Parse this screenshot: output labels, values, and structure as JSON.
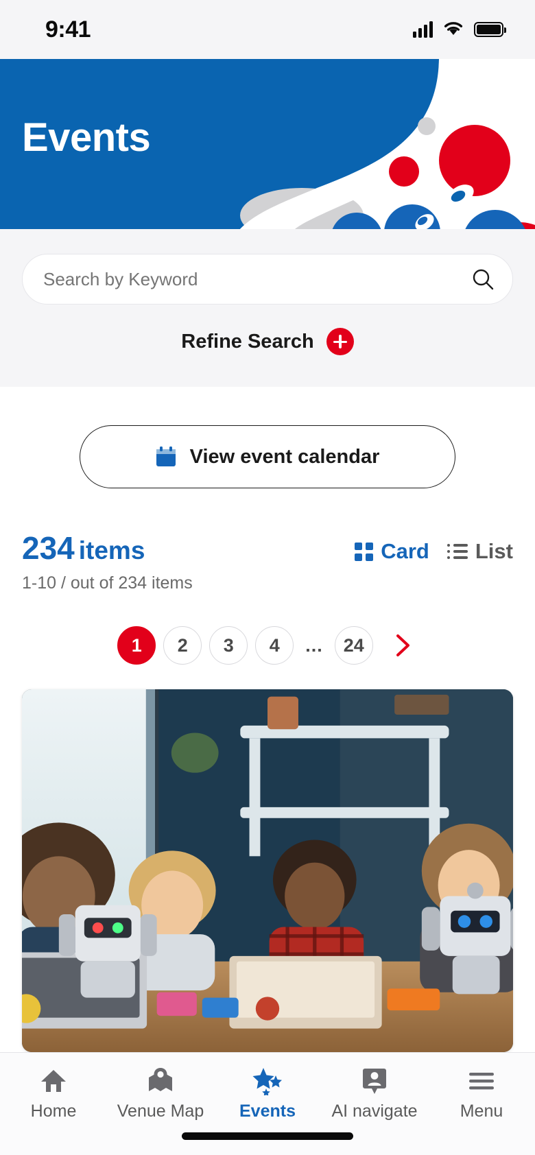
{
  "status_bar": {
    "time": "9:41",
    "cellular_icon": "signal-bars-icon",
    "wifi_icon": "wifi-icon",
    "battery_icon": "battery-full-icon"
  },
  "hero": {
    "title": "Events",
    "background_color": "#0a64b0",
    "accent_red": "#e2001a",
    "accent_blue": "#1565b8",
    "accent_gray": "#d2d2d4"
  },
  "search": {
    "placeholder": "Search by Keyword",
    "value": "",
    "search_icon": "search-icon",
    "refine_label": "Refine Search",
    "refine_icon": "plus-circle-icon"
  },
  "calendar_button": {
    "label": "View event calendar",
    "icon": "calendar-icon"
  },
  "results": {
    "count": "234",
    "count_word": "items",
    "range_text": "1-10 / out of 234 items",
    "view_modes": [
      {
        "label": "Card",
        "icon": "grid-icon",
        "active": true
      },
      {
        "label": "List",
        "icon": "list-icon",
        "active": false
      }
    ]
  },
  "pagination": {
    "pages": [
      "1",
      "2",
      "3",
      "4"
    ],
    "ellipsis": "...",
    "last_page": "24",
    "next_icon": "chevron-right-icon",
    "current": "1"
  },
  "event_card": {
    "image_alt": "children-with-robots-photo"
  },
  "bottom_nav": {
    "items": [
      {
        "label": "Home",
        "icon": "home-icon",
        "active": false
      },
      {
        "label": "Venue Map",
        "icon": "map-pin-icon",
        "active": false
      },
      {
        "label": "Events",
        "icon": "stars-icon",
        "active": true
      },
      {
        "label": "AI navigate",
        "icon": "person-pin-icon",
        "active": false
      },
      {
        "label": "Menu",
        "icon": "hamburger-icon",
        "active": false
      }
    ]
  }
}
